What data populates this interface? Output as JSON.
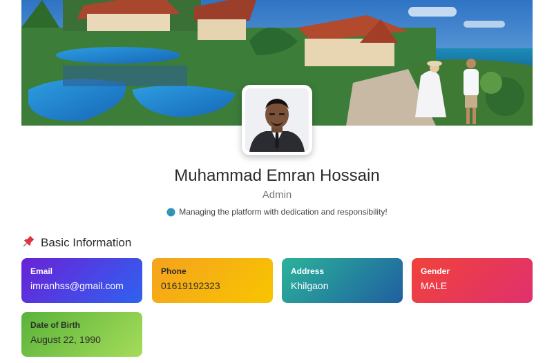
{
  "profile": {
    "name": "Muhammad Emran Hossain",
    "role": "Admin",
    "tagline": "Managing the platform with dedication and responsibility!"
  },
  "section": {
    "title": "Basic Information"
  },
  "cards": {
    "email": {
      "label": "Email",
      "value": "imranhss@gmail.com"
    },
    "phone": {
      "label": "Phone",
      "value": "01619192323"
    },
    "address": {
      "label": "Address",
      "value": "Khilgaon"
    },
    "gender": {
      "label": "Gender",
      "value": "MALE"
    },
    "dob": {
      "label": "Date of Birth",
      "value": "August 22, 1990"
    }
  },
  "icons": {
    "tagline_icon": "globe-icon",
    "section_icon": "pushpin-icon"
  }
}
